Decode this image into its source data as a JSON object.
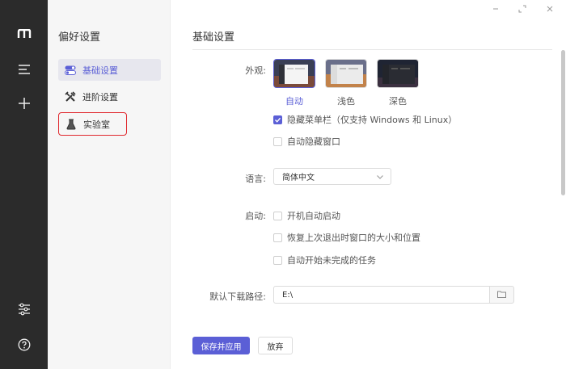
{
  "sidebar": {
    "title": "偏好设置",
    "items": [
      {
        "label": "基础设置"
      },
      {
        "label": "进阶设置"
      },
      {
        "label": "实验室"
      }
    ]
  },
  "main": {
    "title": "基础设置",
    "appearance": {
      "label": "外观:",
      "themes": [
        {
          "label": "自动"
        },
        {
          "label": "浅色"
        },
        {
          "label": "深色"
        }
      ],
      "hide_menubar": "隐藏菜单栏（仅支持 Windows 和 Linux）",
      "auto_hide_window": "自动隐藏窗口"
    },
    "language": {
      "label": "语言:",
      "value": "简体中文"
    },
    "startup": {
      "label": "启动:",
      "options": [
        "开机自动启动",
        "恢复上次退出时窗口的大小和位置",
        "自动开始未完成的任务"
      ]
    },
    "download_path": {
      "label": "默认下载路径:",
      "value": "E:\\"
    },
    "save_button": "保存并应用",
    "discard_button": "放弃"
  },
  "colors": {
    "accent": "#5b5fd6",
    "rail": "#2b2b2b",
    "highlight": "#e0282e"
  }
}
